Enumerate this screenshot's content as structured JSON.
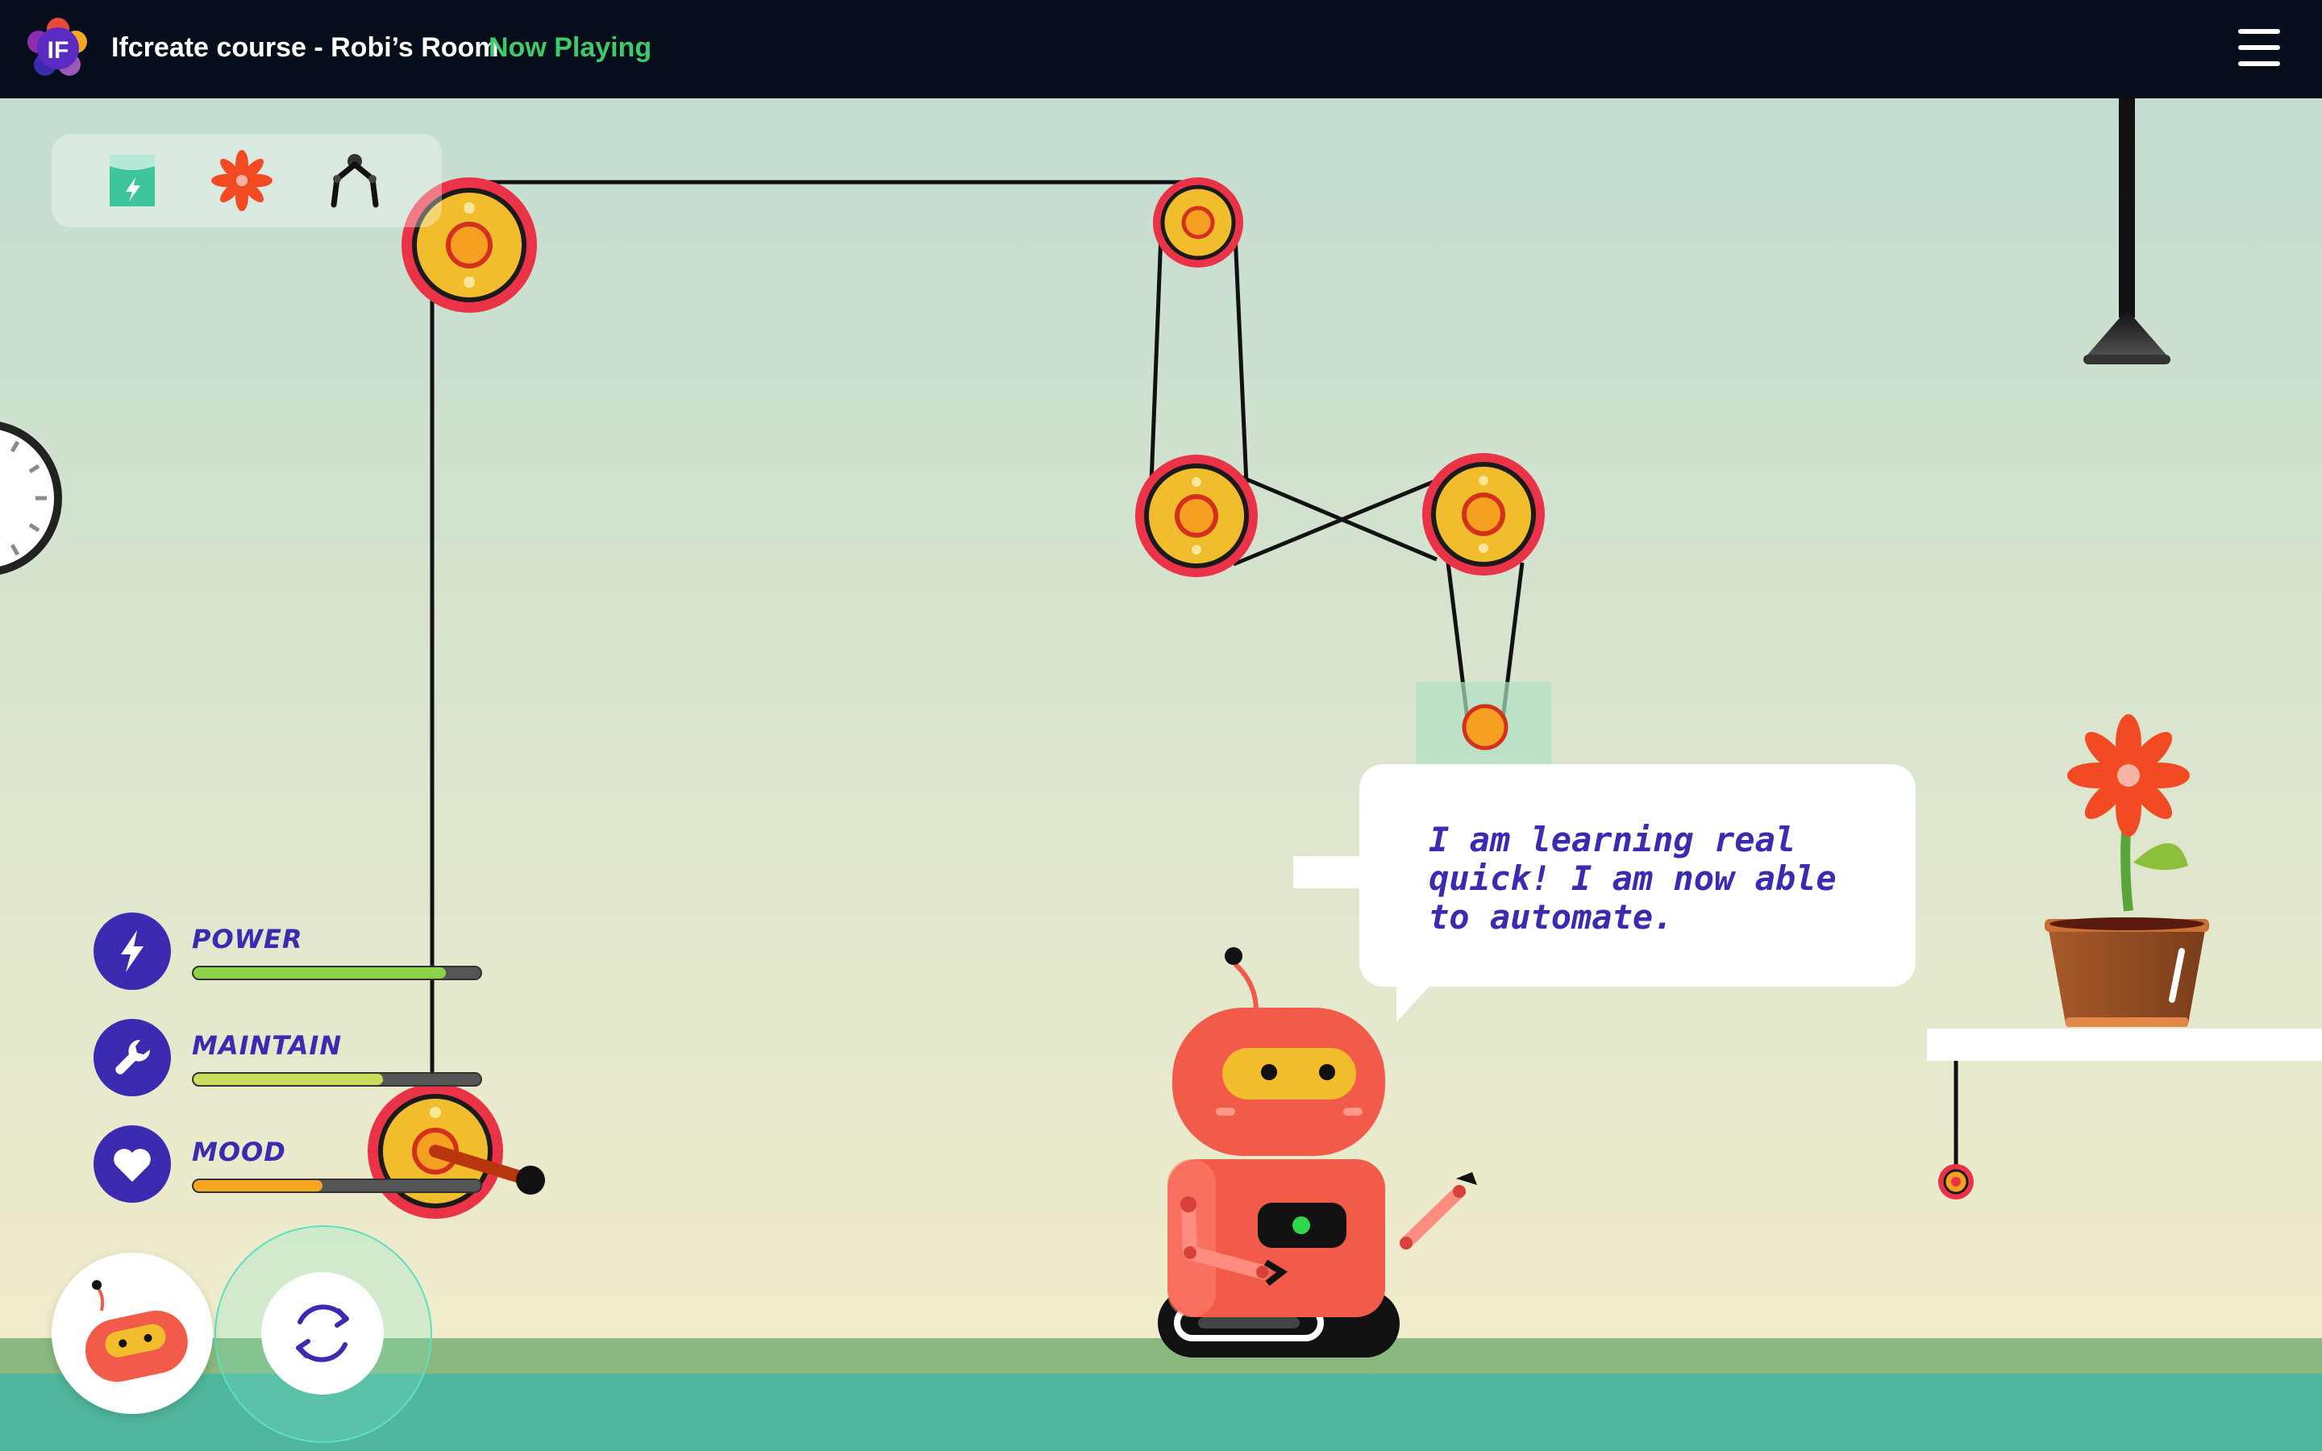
{
  "header": {
    "title": "Ifcreate course - Robi’s Room",
    "status": "Now Playing",
    "logo_text": "IF",
    "menu_icon": "hamburger-menu-icon"
  },
  "toolbox": {
    "tools": [
      {
        "name": "battery-tool",
        "icon": "battery-icon"
      },
      {
        "name": "flower-tool",
        "icon": "flower-icon"
      },
      {
        "name": "claw-tool",
        "icon": "claw-icon"
      }
    ]
  },
  "stats": [
    {
      "label": "POWER",
      "icon": "lightning-icon",
      "level": 0.88,
      "color": "#8ed14a"
    },
    {
      "label": "MAINTAIN",
      "icon": "wrench-icon",
      "level": 0.66,
      "color": "#c7df5a"
    },
    {
      "label": "MOOD",
      "icon": "heart-icon",
      "level": 0.45,
      "color": "#f5a623"
    }
  ],
  "speech_bubble": {
    "text": "I am learning real quick! I am now able to automate."
  },
  "controls": {
    "robot_button_icon": "robot-face-icon",
    "reset_button_icon": "refresh-icon"
  },
  "colors": {
    "accent": "#3a2bb0",
    "status_green": "#3ec96a",
    "header_bg": "#050e1a",
    "pulley_fill": "#f2bd2c",
    "pulley_rim": "#ea3347",
    "robot_red": "#f25a4a"
  }
}
